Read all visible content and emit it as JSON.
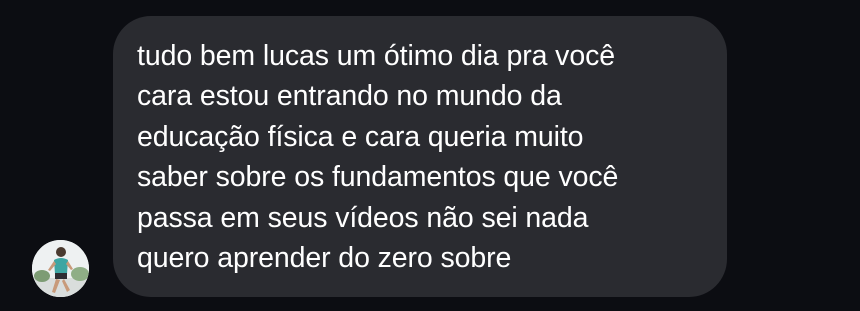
{
  "conversation": {
    "message": {
      "lines": [
        "tudo bem lucas um ótimo dia pra você",
        "cara estou entrando no mundo da",
        "educação física e cara queria muito",
        "saber sobre os fundamentos que você",
        "passa em seus vídeos não sei nada",
        "quero aprender do zero sobre"
      ]
    },
    "avatar_icon": "runner-photo-avatar"
  },
  "colors": {
    "background": "#0c0d12",
    "bubble": "#2a2b30",
    "text": "#ffffff"
  }
}
